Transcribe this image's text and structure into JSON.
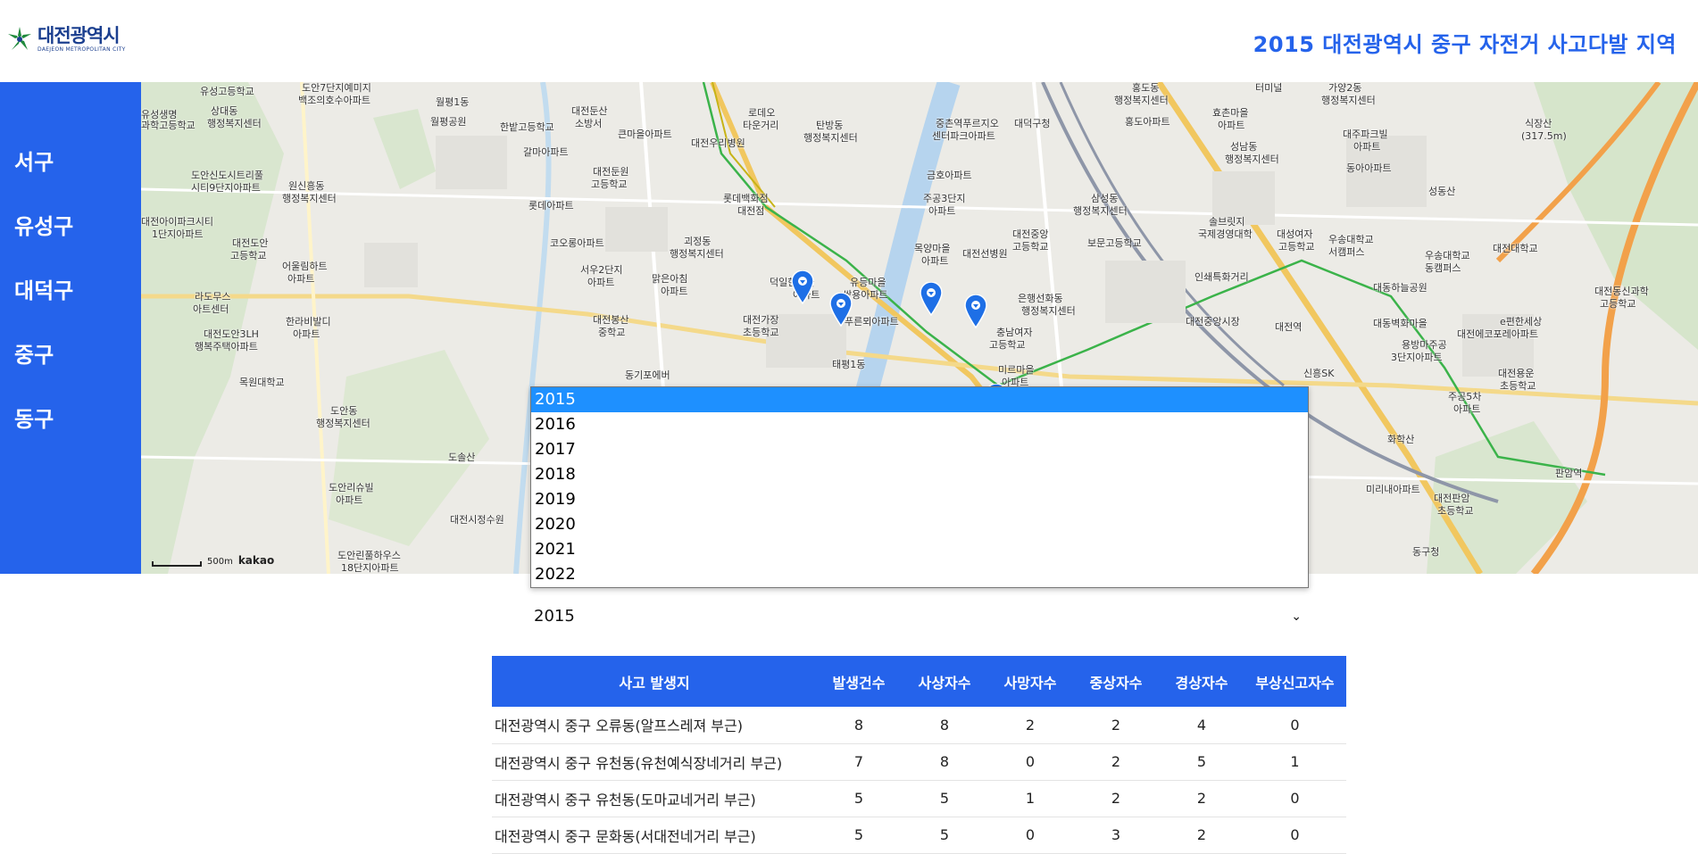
{
  "header": {
    "logo_text": "대전광역시",
    "logo_sub": "DAEJEON METROPOLITAN CITY",
    "title": "2015 대전광역시 중구 자전거 사고다발 지역"
  },
  "sidebar": {
    "items": [
      {
        "label": "서구"
      },
      {
        "label": "유성구"
      },
      {
        "label": "대덕구"
      },
      {
        "label": "중구"
      },
      {
        "label": "동구"
      }
    ]
  },
  "map": {
    "labels": [
      "유성고등학교",
      "도안7단지예미지",
      "백조의호수아파트",
      "월평1동",
      "월평공원",
      "상대동",
      "행정복지센터",
      "유성생명",
      "과학고등학교",
      "원신흥동",
      "행정복지센터",
      "도안신도시트리풀",
      "시티9단지아파트",
      "대전아이파크시티",
      "1단지아파트",
      "대전도안",
      "고등학교",
      "어울림하트",
      "아파트",
      "라도무스",
      "아트센터",
      "대전도안3LH",
      "행복주택아파트",
      "한라비발디",
      "아파트",
      "목원대학교",
      "도안동",
      "행정복지센터",
      "도솔산",
      "도안리슈빌",
      "아파트",
      "대전시정수원",
      "도안린풀하우스",
      "18단지아파트",
      "한밭고등학교",
      "대전둔산",
      "소방서",
      "갈마아파트",
      "큰마을아파트",
      "대전둔원",
      "고등학교",
      "롯데아파트",
      "코오롱아파트",
      "서우2단지",
      "아파트",
      "대전봉산",
      "중학교",
      "동기포에버",
      "대전우리병원",
      "로데오",
      "타운거리",
      "탄방동",
      "행정복지센터",
      "롯데백화점",
      "대전점",
      "괴정동",
      "행정복지센터",
      "맑은아침",
      "아파트",
      "덕일한마을",
      "아파트",
      "유등마을",
      "쌍용아파트",
      "대전가장",
      "초등학교",
      "푸른뫼아파트",
      "태평1동",
      "중촌역푸르지오",
      "센터파크아파트",
      "금호아파트",
      "주공3단지",
      "아파트",
      "목양마을",
      "아파트",
      "대전선병원",
      "대덕구청",
      "충남여자",
      "고등학교",
      "미르마을",
      "아파트",
      "은행선화동",
      "행정복지센터",
      "대전중앙",
      "고등학교",
      "삼성동",
      "행정복지센터",
      "보문고등학교",
      "홍도동",
      "행정복지센터",
      "홍도아파트",
      "효촌마을",
      "아파트",
      "성남동",
      "행정복지센터",
      "솔브릿지",
      "국제경영대학",
      "대성여자",
      "고등학교",
      "우송대학교",
      "서캠퍼스",
      "인쇄특화거리",
      "대전중앙시장",
      "대동하늘공원",
      "가양2동",
      "행정복지센터",
      "대주파크빌",
      "아파트",
      "동아아파트",
      "성동산",
      "우송대학교",
      "동캠퍼스",
      "대전대학교",
      "대동벽화마을",
      "용방마주공",
      "3단지아파트",
      "e편한세상",
      "대전에코포레아파트",
      "대전용운",
      "초등학교",
      "주공5차",
      "아파트",
      "대전동신과학",
      "고등학교",
      "대전판암",
      "초등학교",
      "미리내아파트",
      "동구청",
      "식장산",
      "(317.5m)",
      "화학산",
      "판암역",
      "터미널",
      "대전역",
      "신흥SK"
    ],
    "scale_text": "500m",
    "kakao_text": "kakao"
  },
  "year_select": {
    "selected": "2015",
    "options": [
      "2015",
      "2016",
      "2017",
      "2018",
      "2019",
      "2020",
      "2021",
      "2022"
    ]
  },
  "table": {
    "headers": [
      "사고 발생지",
      "발생건수",
      "사상자수",
      "사망자수",
      "중상자수",
      "경상자수",
      "부상신고자수"
    ],
    "rows": [
      [
        "대전광역시 중구 오류동(알프스레져 부근)",
        "8",
        "8",
        "2",
        "2",
        "4",
        "0"
      ],
      [
        "대전광역시 중구 유천동(유천예식장네거리 부근)",
        "7",
        "8",
        "0",
        "2",
        "5",
        "1"
      ],
      [
        "대전광역시 중구 유천동(도마교네거리 부근)",
        "5",
        "5",
        "1",
        "2",
        "2",
        "0"
      ],
      [
        "대전광역시 중구 문화동(서대전네거리 부근)",
        "5",
        "5",
        "0",
        "3",
        "2",
        "0"
      ]
    ]
  },
  "colors": {
    "primary": "#2563eb",
    "logo": "#1b3f8f",
    "selected_option": "#1e90ff",
    "map_bg": "#ecebe6",
    "marker": "#1e6fe6"
  }
}
